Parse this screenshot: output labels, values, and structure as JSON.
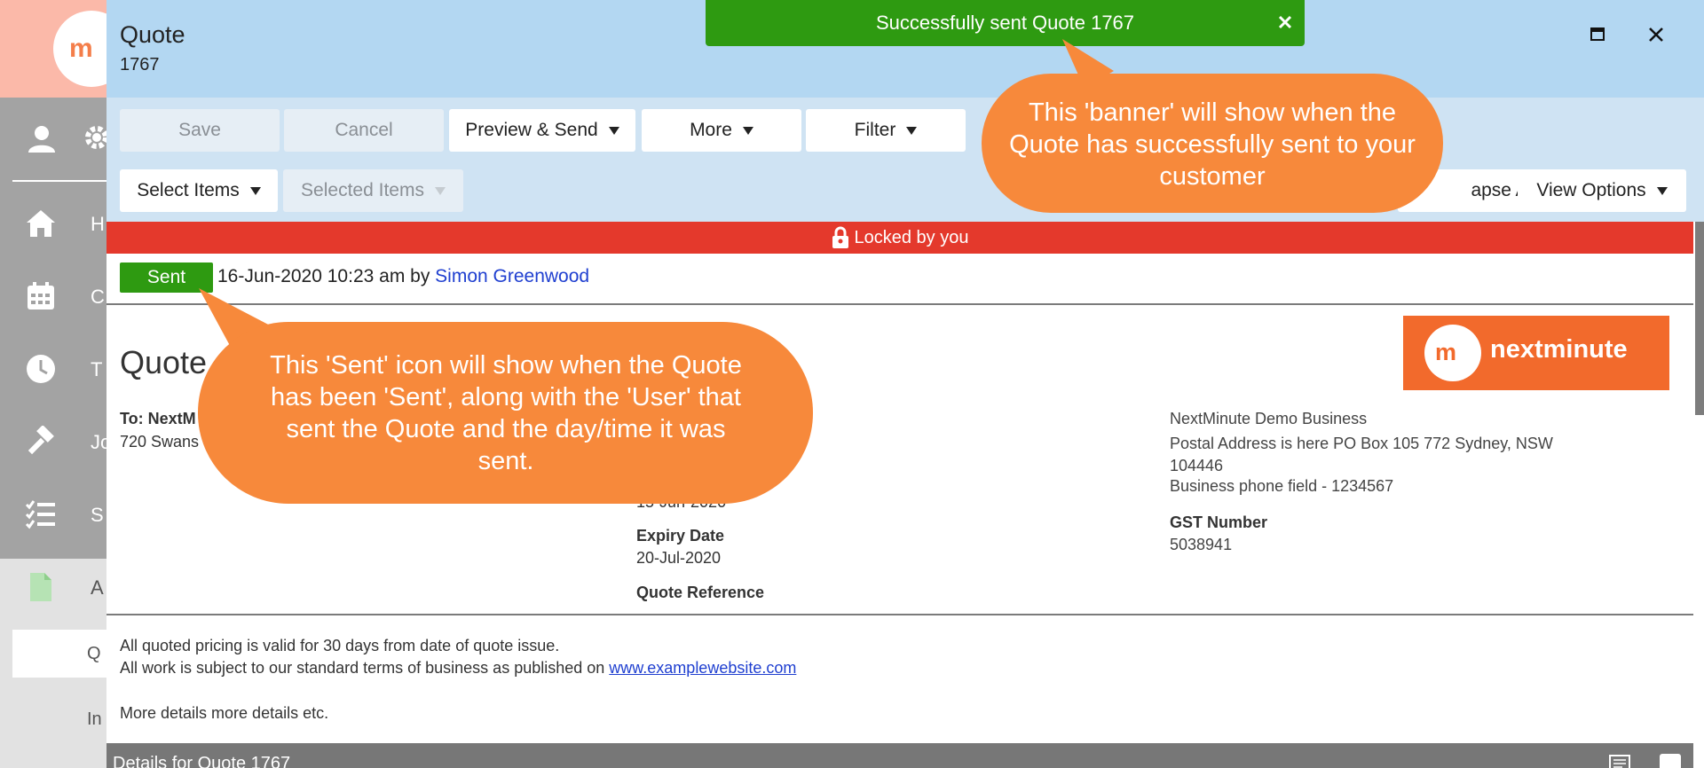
{
  "app": {
    "logo_text": "m",
    "nav_items": [
      {
        "icon": "home-icon",
        "label": "H"
      },
      {
        "icon": "calendar-icon",
        "label": "C"
      },
      {
        "icon": "clock-icon",
        "label": "T"
      },
      {
        "icon": "hammer-icon",
        "label": "Jo"
      },
      {
        "icon": "checklist-icon",
        "label": "S"
      },
      {
        "icon": "document-icon",
        "label": "A"
      }
    ],
    "sub_items": [
      {
        "label": "Q"
      },
      {
        "label": "In"
      }
    ]
  },
  "modal": {
    "title": "Quote",
    "subtitle": "1767"
  },
  "toolbar": {
    "save_label": "Save",
    "cancel_label": "Cancel",
    "preview_send_label": "Preview & Send",
    "more_label": "More",
    "filter_label": "Filter",
    "select_items_label": "Select Items",
    "selected_items_label": "Selected Items",
    "collapse_all_label": "apse All",
    "view_options_label": "View Options"
  },
  "lock": {
    "text": "Locked by you"
  },
  "status": {
    "badge": "Sent",
    "meta_prefix": "16-Jun-2020 10:23 am by ",
    "user": "Simon Greenwood"
  },
  "document": {
    "title": "Quote",
    "to_label": "To: NextM",
    "to_address": "720 Swans",
    "date_partial": "15-Jun-2020",
    "expiry_label": "Expiry Date",
    "expiry_value": "20-Jul-2020",
    "quote_ref_label": "Quote Reference",
    "brand_logo_text": "m",
    "brand_name": "nextminute",
    "business_name": "NextMinute Demo Business",
    "business_address": "Postal Address is here PO Box 105 772 Sydney, NSW 104446",
    "business_phone": "Business phone field - 1234567",
    "gst_label": "GST Number",
    "gst_value": "5038941",
    "term_line1": "All quoted pricing is valid for 30 days from date of quote issue.",
    "term_line2_prefix": "All work is subject to our standard terms of business as published on ",
    "term_line2_link": "www.examplewebsite.com",
    "term_line3": "More details more details etc.",
    "details_title": "Details for Quote 1767"
  },
  "toast": {
    "text": "Successfully sent Quote 1767",
    "color": "#2e9a11"
  },
  "callouts": {
    "banner_note": "This 'banner' will show when the Quote has successfully sent to your customer",
    "sent_note": "This 'Sent' icon will show when the Quote has been 'Sent', along with the 'User' that sent the Quote and the day/time it was sent.",
    "color": "#f7893b"
  },
  "colors": {
    "header_bg": "#b3d7f2",
    "locked_bar": "#e4392c",
    "sent_badge": "#2e9a11",
    "brand": "#f26a2c"
  }
}
